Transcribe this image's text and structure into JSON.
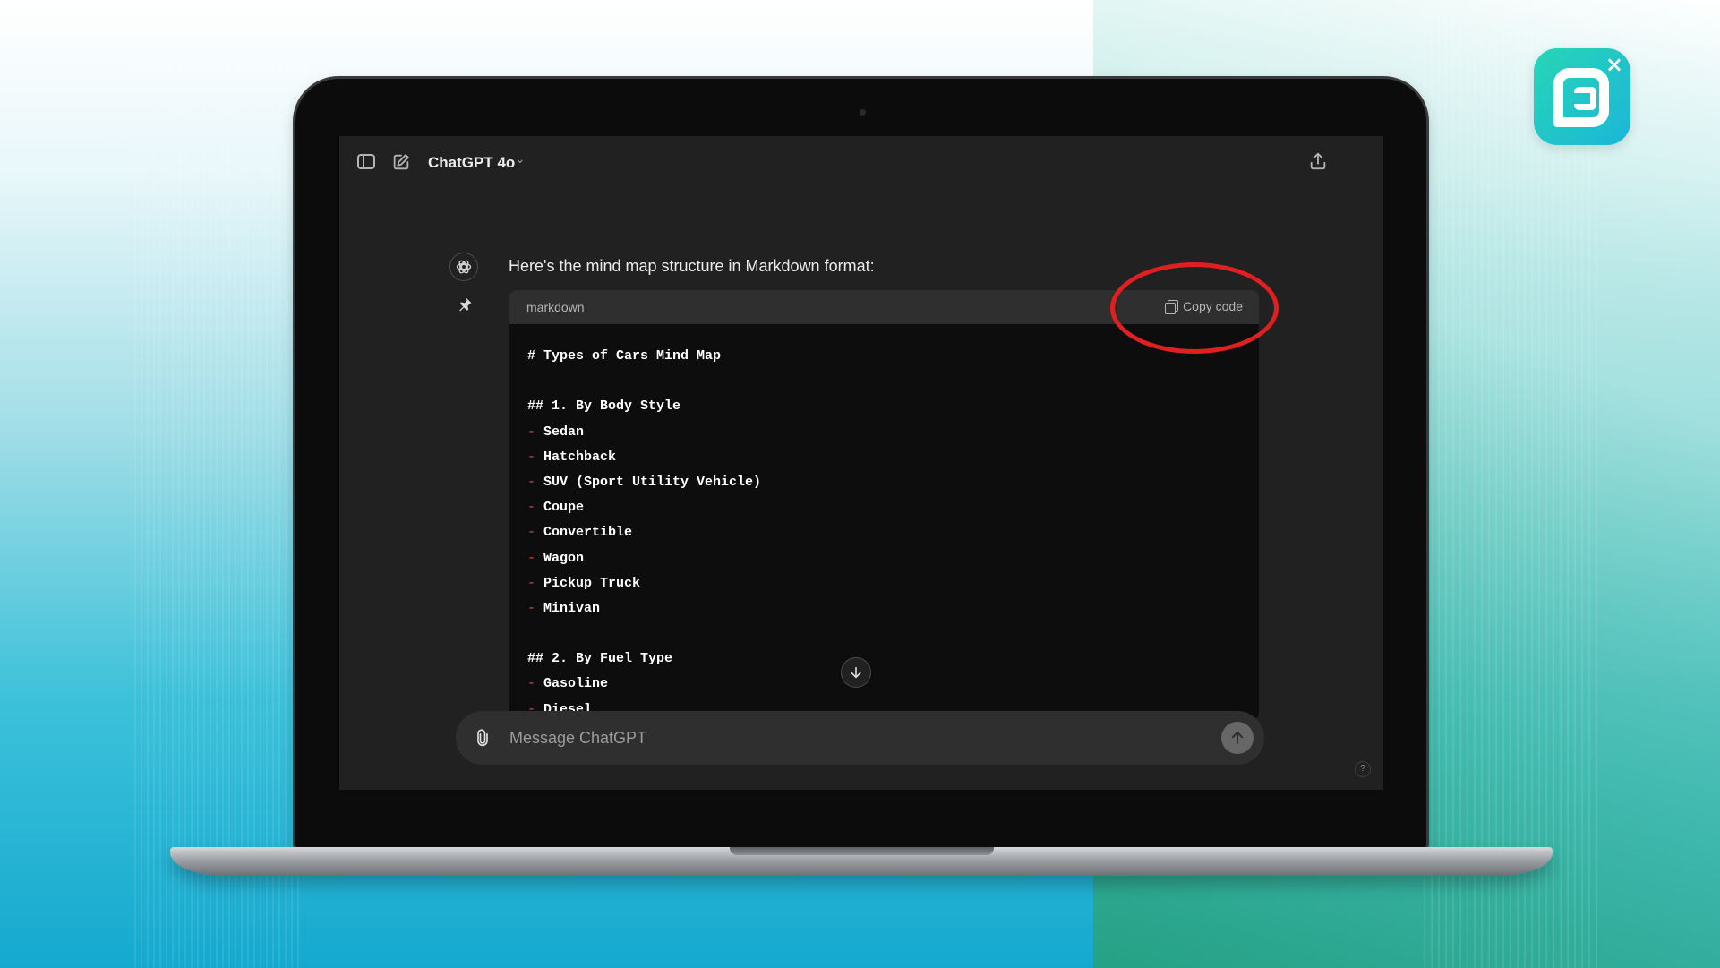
{
  "header": {
    "model_name": "ChatGPT 4o"
  },
  "message": {
    "intro_text": "Here's the mind map structure in Markdown format:"
  },
  "code_block": {
    "language": "markdown",
    "copy_label": "Copy code",
    "lines": [
      {
        "text": "# Types of Cars Mind Map",
        "bullet": false
      },
      {
        "text": "",
        "bullet": false
      },
      {
        "text": "## 1. By Body Style",
        "bullet": false
      },
      {
        "text": "Sedan",
        "bullet": true
      },
      {
        "text": "Hatchback",
        "bullet": true
      },
      {
        "text": "SUV (Sport Utility Vehicle)",
        "bullet": true
      },
      {
        "text": "Coupe",
        "bullet": true
      },
      {
        "text": "Convertible",
        "bullet": true
      },
      {
        "text": "Wagon",
        "bullet": true
      },
      {
        "text": "Pickup Truck",
        "bullet": true
      },
      {
        "text": "Minivan",
        "bullet": true
      },
      {
        "text": "",
        "bullet": false
      },
      {
        "text": "## 2. By Fuel Type",
        "bullet": false
      },
      {
        "text": "Gasoline",
        "bullet": true
      },
      {
        "text": "Diesel",
        "bullet": true
      }
    ]
  },
  "composer": {
    "placeholder": "Message ChatGPT"
  },
  "help": {
    "label": "?"
  },
  "colors": {
    "screen_bg": "#212121",
    "code_bg": "#0d0d0d",
    "bullet_dash": "#e04a4a",
    "annotation_ring": "#e02020",
    "logo_gradient_start": "#27d6b6",
    "logo_gradient_end": "#1bb6d9"
  },
  "icons": {
    "logo": "brand-p-logo-icon",
    "sidebar": "sidebar-toggle-icon",
    "new_chat": "edit-icon",
    "share": "share-icon",
    "avatar": "openai-icon",
    "pin": "pin-icon",
    "copy": "copy-icon",
    "scroll": "arrow-down-icon",
    "attach": "paperclip-icon",
    "send": "arrow-up-icon"
  }
}
